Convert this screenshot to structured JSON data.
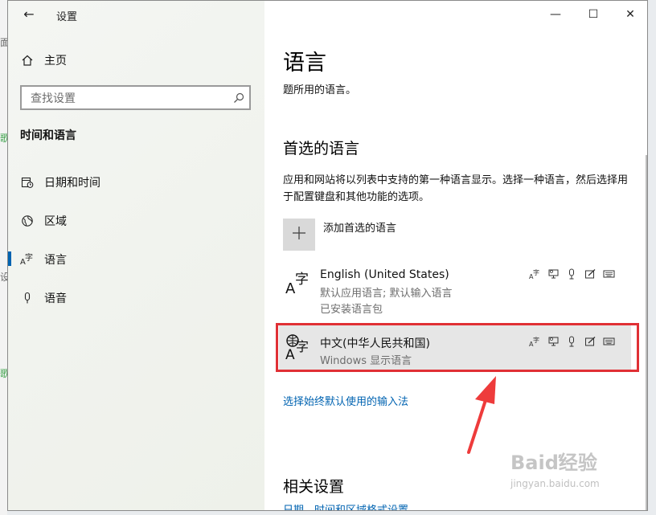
{
  "window": {
    "title": "设置",
    "back_glyph": "←",
    "minimize_glyph": "—",
    "maximize_glyph": "☐",
    "close_glyph": "✕"
  },
  "sidebar": {
    "home_label": "主页",
    "search_placeholder": "查找设置",
    "section_title": "时间和语言",
    "items": [
      {
        "label": "日期和时间",
        "icon": "calendar-clock-icon"
      },
      {
        "label": "区域",
        "icon": "globe-icon"
      },
      {
        "label": "语言",
        "icon": "language-icon",
        "selected": true
      },
      {
        "label": "语音",
        "icon": "microphone-icon"
      }
    ]
  },
  "main": {
    "page_title": "语言",
    "subtitle": "题所用的语言。",
    "preferred_heading": "首选的语言",
    "preferred_description": "应用和网站将以列表中支持的第一种语言显示。选择一种语言，然后选择用于配置键盘和其他功能的选项。",
    "add_button_label": "添加首选的语言",
    "languages": [
      {
        "name": "English (United States)",
        "details": [
          "默认应用语言; 默认输入语言",
          "已安装语言包"
        ],
        "selected": false
      },
      {
        "name": "中文(中华人民共和国)",
        "details": [
          "Windows 显示语言"
        ],
        "selected": true
      }
    ],
    "input_method_link": "选择始终默认使用的输入法",
    "related_heading": "相关设置",
    "related_link": "日期、时间和区域格式设置"
  },
  "watermark": {
    "text": "Baiď经验",
    "sub": "jingyan.baidu.com"
  },
  "colors": {
    "accent": "#0063b1",
    "highlight": "#e03035",
    "arrow": "#ee3b3b"
  }
}
